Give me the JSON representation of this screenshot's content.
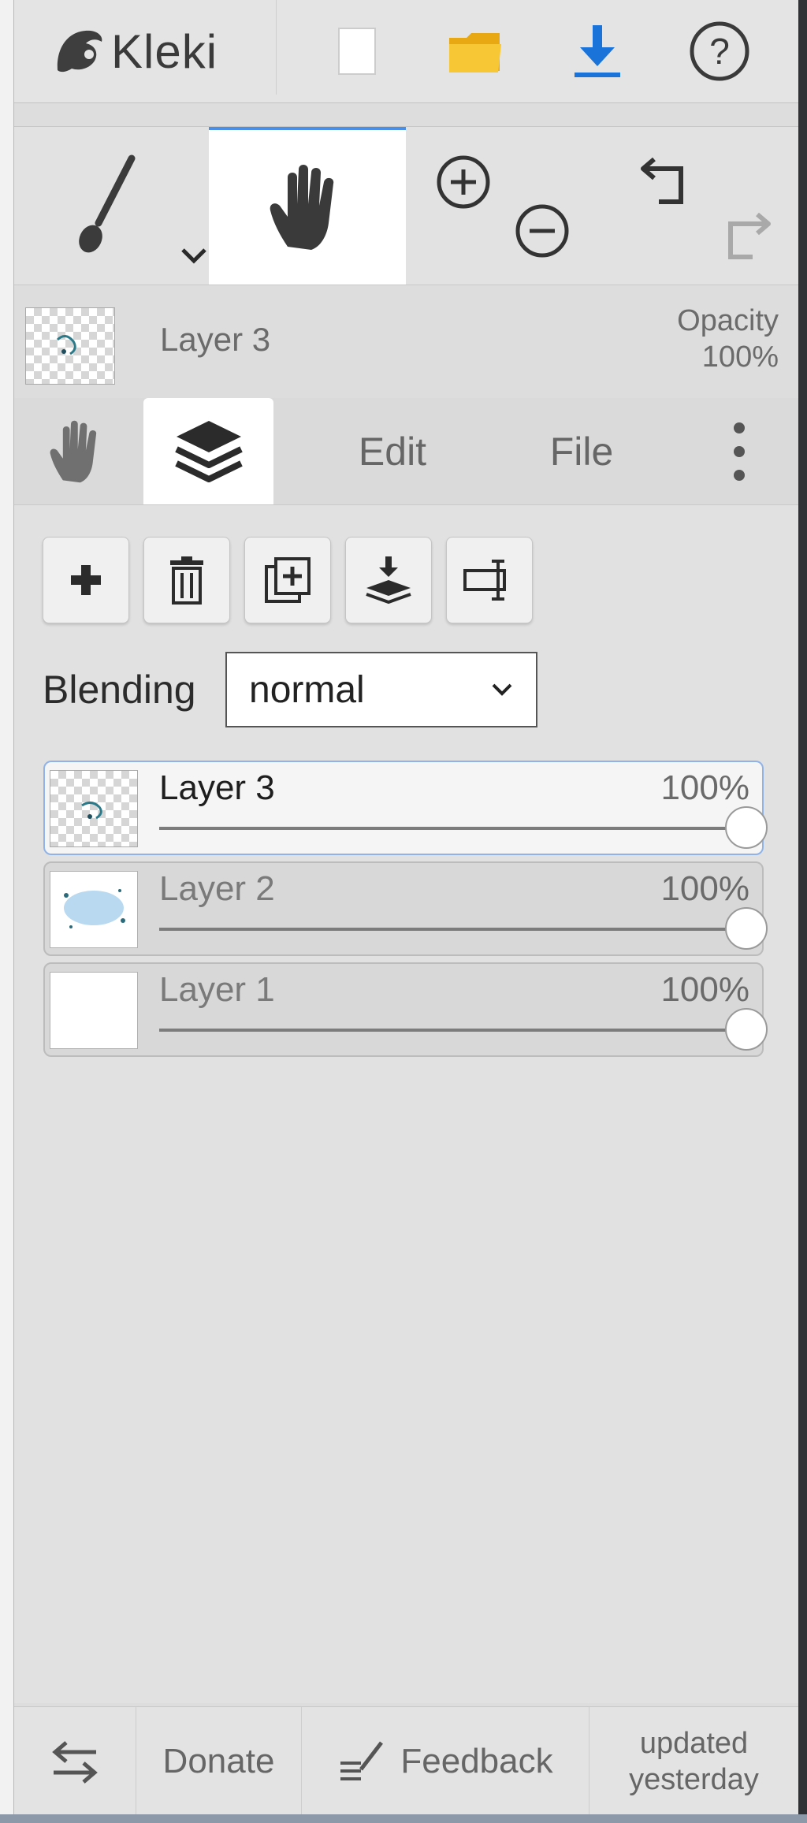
{
  "app": {
    "name": "Kleki"
  },
  "topbar": {
    "buttons": [
      {
        "name": "new-image",
        "icon": "blank-page-icon"
      },
      {
        "name": "open",
        "icon": "folder-icon"
      },
      {
        "name": "save",
        "icon": "download-icon"
      },
      {
        "name": "help",
        "icon": "question-mark-icon"
      }
    ]
  },
  "tools": {
    "active": "hand",
    "items": [
      "brush",
      "hand",
      "zoom-in",
      "zoom-out",
      "undo",
      "redo"
    ]
  },
  "active_layer": {
    "name": "Layer 3",
    "opacity_label": "Opacity",
    "opacity_value": "100%"
  },
  "panel_tabs": {
    "active": "layers",
    "edit_label": "Edit",
    "file_label": "File"
  },
  "layers_panel": {
    "actions": [
      "add-layer",
      "delete-layer",
      "duplicate-layer",
      "merge-down",
      "rename-layer"
    ],
    "blending_label": "Blending",
    "blending_value": "normal",
    "layers": [
      {
        "name": "Layer 3",
        "opacity": "100%",
        "opacity_fraction": 1.0,
        "active": true
      },
      {
        "name": "Layer 2",
        "opacity": "100%",
        "opacity_fraction": 1.0,
        "active": false
      },
      {
        "name": "Layer 1",
        "opacity": "100%",
        "opacity_fraction": 1.0,
        "active": false
      }
    ]
  },
  "footer": {
    "donate_label": "Donate",
    "feedback_label": "Feedback",
    "updated_line1": "updated",
    "updated_line2": "yesterday"
  },
  "colors": {
    "accent": "#4a8fe7",
    "save_icon": "#1a73d9",
    "folder_icon": "#f2b824",
    "active_layer_border": "#8fb3e8"
  }
}
